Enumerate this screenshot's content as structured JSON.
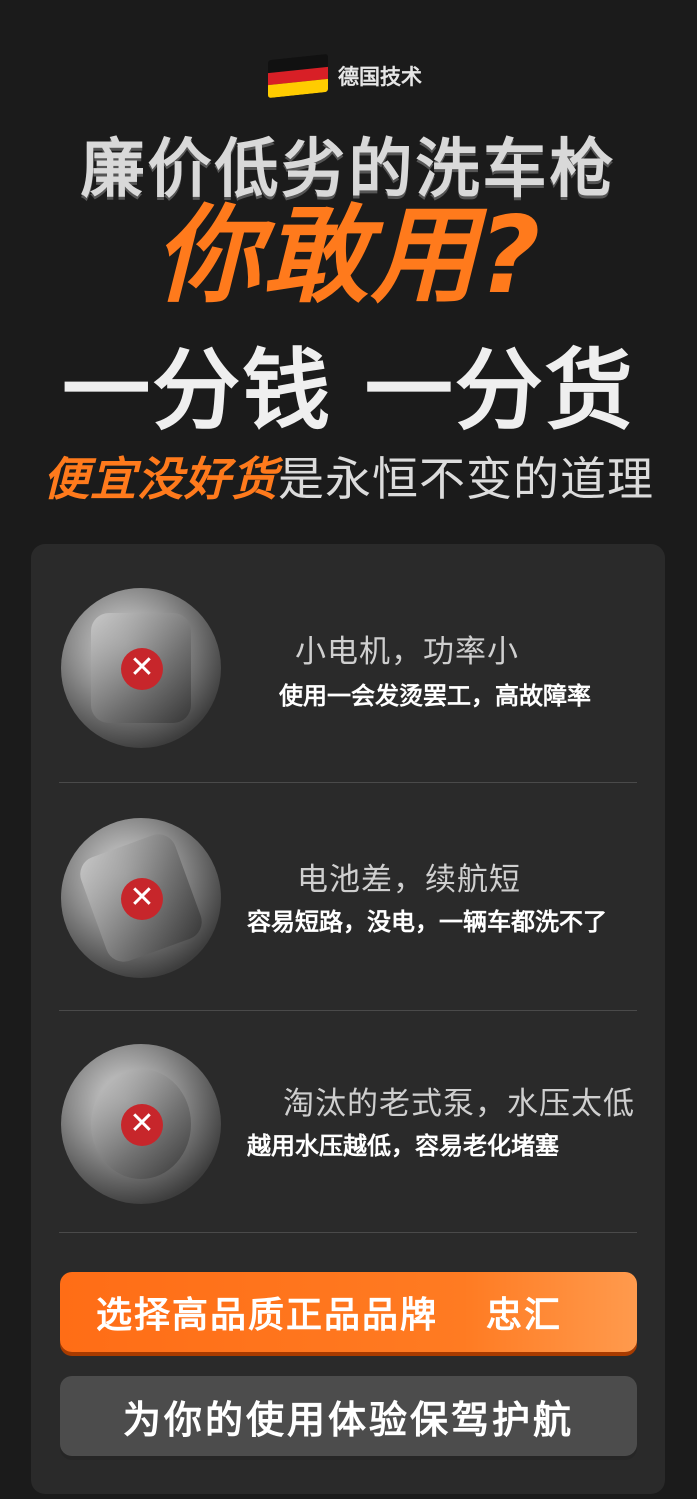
{
  "badge": {
    "text": "德国技术",
    "icon": "german-flag-icon"
  },
  "headline": {
    "line1": "廉价低劣的洗车枪",
    "line2": "你敢用?",
    "line3": "一分钱 一分货",
    "line4_highlight": "便宜没好货",
    "line4_rest": "是永恒不变的道理"
  },
  "items": [
    {
      "icon": "motor-icon",
      "title": "小电机，功率小",
      "subtitle": "使用一会发烫罢工，高故障率"
    },
    {
      "icon": "battery-icon",
      "title": "电池差，续航短",
      "subtitle": "容易短路，没电，一辆车都洗不了"
    },
    {
      "icon": "pump-icon",
      "title": "淘汰的老式泵，水压太低",
      "subtitle": "越用水压越低，容易老化堵塞"
    }
  ],
  "cta": {
    "primary_label": "选择高品质正品品牌",
    "brand": "忠汇",
    "secondary_label": "为你的使用体验保驾护航"
  },
  "colors": {
    "accent": "#ff7a1c",
    "error": "#c7262b",
    "background": "#1b1b1b",
    "card": "#2a2a2a"
  }
}
